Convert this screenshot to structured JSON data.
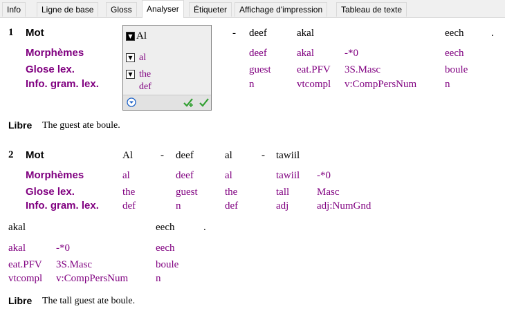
{
  "tabs": [
    {
      "label": "Info",
      "active": false
    },
    {
      "label": "Ligne de base",
      "active": false
    },
    {
      "label": "Gloss",
      "active": false
    },
    {
      "label": "Analyser",
      "active": true
    },
    {
      "label": "Étiqueter",
      "active": false
    },
    {
      "label": "Affichage d'impression",
      "active": false
    },
    {
      "label": "Tableau de texte",
      "active": false
    }
  ],
  "row_labels": {
    "word": "Mot",
    "morphemes": "Morphèmes",
    "lex_gloss": "Glose lex.",
    "gram_info": "Info. gram. lex.",
    "free": "Libre"
  },
  "colors": {
    "label_purple": "#800080",
    "check_green": "#2e9e2e",
    "nav_blue": "#1e63c8"
  },
  "seg1": {
    "number": "1",
    "sandbox": {
      "word": "Al",
      "morph": "al",
      "gloss": "the",
      "gram": "def",
      "icons": [
        "arrow-down-icon",
        "check-all-icon",
        "check-icon"
      ]
    },
    "dash": "-",
    "words": [
      "deef",
      "akal",
      "eech",
      "."
    ],
    "morphs": [
      "deef",
      "akal",
      "-*0",
      "eech"
    ],
    "glosses": [
      "guest",
      "eat.PFV",
      "3S.Masc",
      "boule"
    ],
    "grams": [
      "n",
      "vtcompl",
      "v:CompPersNum",
      "n"
    ],
    "free": "The guest ate boule."
  },
  "seg2": {
    "number": "2",
    "words": [
      "Al",
      "-",
      "deef",
      "al",
      "-",
      "tawiil"
    ],
    "morphs": [
      "al",
      "deef",
      "al",
      "tawiil",
      "-*0"
    ],
    "glosses": [
      "the",
      "guest",
      "the",
      "tall",
      "Masc"
    ],
    "grams": [
      "def",
      "n",
      "def",
      "adj",
      "adj:NumGnd"
    ],
    "wrap_words": [
      "akal",
      "eech",
      "."
    ],
    "wrap_morphs": [
      "akal",
      "-*0",
      "eech"
    ],
    "wrap_glosses": [
      "eat.PFV",
      "3S.Masc",
      "boule"
    ],
    "wrap_grams": [
      "vtcompl",
      "v:CompPersNum",
      "n"
    ],
    "free": "The tall guest ate boule."
  }
}
